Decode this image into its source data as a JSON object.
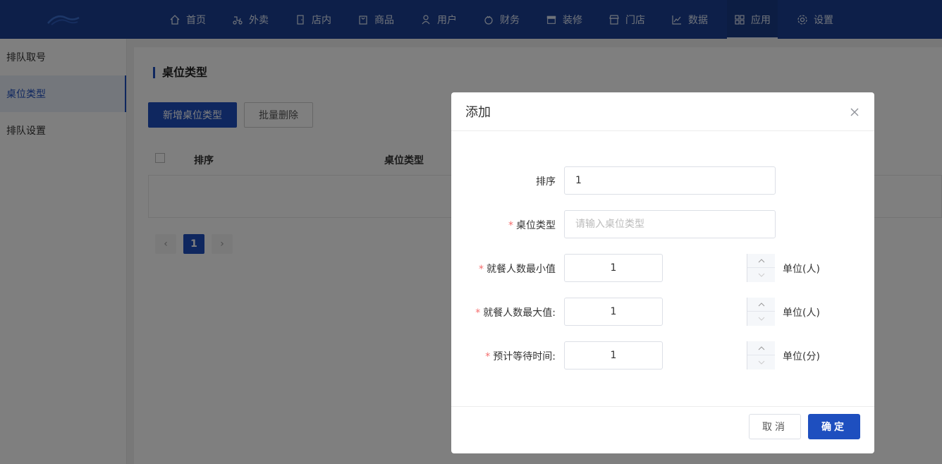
{
  "nav": {
    "items": [
      {
        "label": "首页",
        "icon": "home-icon"
      },
      {
        "label": "外卖",
        "icon": "scooter-icon"
      },
      {
        "label": "店内",
        "icon": "door-icon"
      },
      {
        "label": "商品",
        "icon": "bag-icon"
      },
      {
        "label": "用户",
        "icon": "user-icon"
      },
      {
        "label": "财务",
        "icon": "money-icon"
      },
      {
        "label": "装修",
        "icon": "shop-icon"
      },
      {
        "label": "门店",
        "icon": "store-icon"
      },
      {
        "label": "数据",
        "icon": "chart-icon"
      },
      {
        "label": "应用",
        "icon": "apps-icon"
      },
      {
        "label": "设置",
        "icon": "gear-icon"
      }
    ],
    "active": "应用"
  },
  "sidebar": {
    "items": [
      {
        "label": "排队取号"
      },
      {
        "label": "桌位类型"
      },
      {
        "label": "排队设置"
      }
    ],
    "active": "桌位类型"
  },
  "main": {
    "title": "桌位类型",
    "add_button": "新增桌位类型",
    "batch_delete_button": "批量删除",
    "table": {
      "columns": [
        "排序",
        "桌位类型"
      ]
    },
    "pager": {
      "prev": "‹",
      "current": "1",
      "next": "›"
    }
  },
  "dialog": {
    "title": "添加",
    "close": "×",
    "fields": {
      "sort": {
        "label": "排序",
        "value": "1"
      },
      "table_type": {
        "label": "桌位类型",
        "placeholder": "请输入桌位类型",
        "required": "*"
      },
      "min_people": {
        "label": "就餐人数最小值",
        "value": "1",
        "unit": "单位(人)",
        "required": "*"
      },
      "max_people": {
        "label": "就餐人数最大值:",
        "value": "1",
        "unit": "单位(人)",
        "required": "*"
      },
      "wait_time": {
        "label": "预计等待时间:",
        "value": "1",
        "unit": "单位(分)",
        "required": "*"
      }
    },
    "cancel": "取消",
    "confirm": "确定"
  },
  "colors": {
    "nav_bg": "#1a3f93",
    "primary": "#1e4fbf",
    "required": "#f56c6c"
  }
}
